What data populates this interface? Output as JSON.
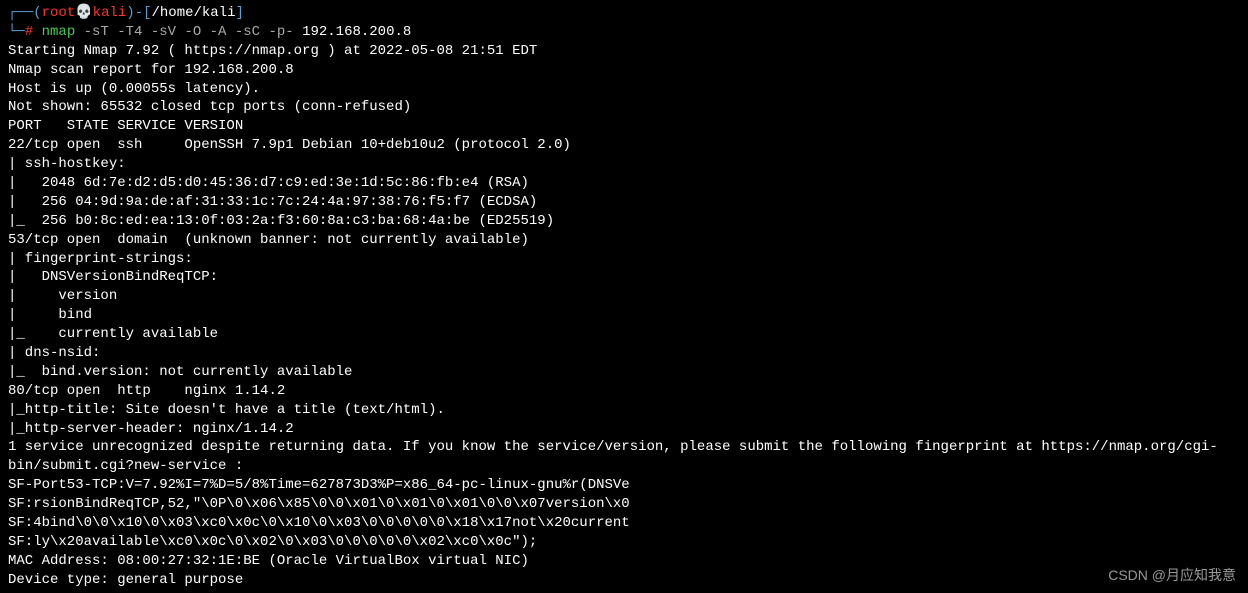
{
  "prompt": {
    "line1": {
      "box_tl": "┌──",
      "open_paren": "(",
      "user": "root",
      "skull": "💀",
      "host": "kali",
      "close_paren": ")",
      "dash": "-",
      "open_bracket": "[",
      "path": "/home/kali",
      "close_bracket": "]"
    },
    "line2": {
      "box_bl": "└─",
      "hash": "#",
      "cmd": " nmap",
      "args_colored": " -sT -T4 -sV -O -A -sC -p-",
      "target": " 192.168.200.8"
    }
  },
  "output": [
    "Starting Nmap 7.92 ( https://nmap.org ) at 2022-05-08 21:51 EDT",
    "Nmap scan report for 192.168.200.8",
    "Host is up (0.00055s latency).",
    "Not shown: 65532 closed tcp ports (conn-refused)",
    "PORT   STATE SERVICE VERSION",
    "22/tcp open  ssh     OpenSSH 7.9p1 Debian 10+deb10u2 (protocol 2.0)",
    "| ssh-hostkey:",
    "|   2048 6d:7e:d2:d5:d0:45:36:d7:c9:ed:3e:1d:5c:86:fb:e4 (RSA)",
    "|   256 04:9d:9a:de:af:31:33:1c:7c:24:4a:97:38:76:f5:f7 (ECDSA)",
    "|_  256 b0:8c:ed:ea:13:0f:03:2a:f3:60:8a:c3:ba:68:4a:be (ED25519)",
    "53/tcp open  domain  (unknown banner: not currently available)",
    "| fingerprint-strings:",
    "|   DNSVersionBindReqTCP:",
    "|     version",
    "|     bind",
    "|_    currently available",
    "| dns-nsid:",
    "|_  bind.version: not currently available",
    "80/tcp open  http    nginx 1.14.2",
    "|_http-title: Site doesn't have a title (text/html).",
    "|_http-server-header: nginx/1.14.2",
    "1 service unrecognized despite returning data. If you know the service/version, please submit the following fingerprint at https://nmap.org/cgi-bin/submit.cgi?new-service :",
    "SF-Port53-TCP:V=7.92%I=7%D=5/8%Time=627873D3%P=x86_64-pc-linux-gnu%r(DNSVe",
    "SF:rsionBindReqTCP,52,\"\\0P\\0\\x06\\x85\\0\\0\\x01\\0\\x01\\0\\x01\\0\\0\\x07version\\x0",
    "SF:4bind\\0\\0\\x10\\0\\x03\\xc0\\x0c\\0\\x10\\0\\x03\\0\\0\\0\\0\\0\\x18\\x17not\\x20current",
    "SF:ly\\x20available\\xc0\\x0c\\0\\x02\\0\\x03\\0\\0\\0\\0\\0\\x02\\xc0\\x0c\");",
    "MAC Address: 08:00:27:32:1E:BE (Oracle VirtualBox virtual NIC)",
    "Device type: general purpose"
  ],
  "watermark": "CSDN @月应知我意"
}
